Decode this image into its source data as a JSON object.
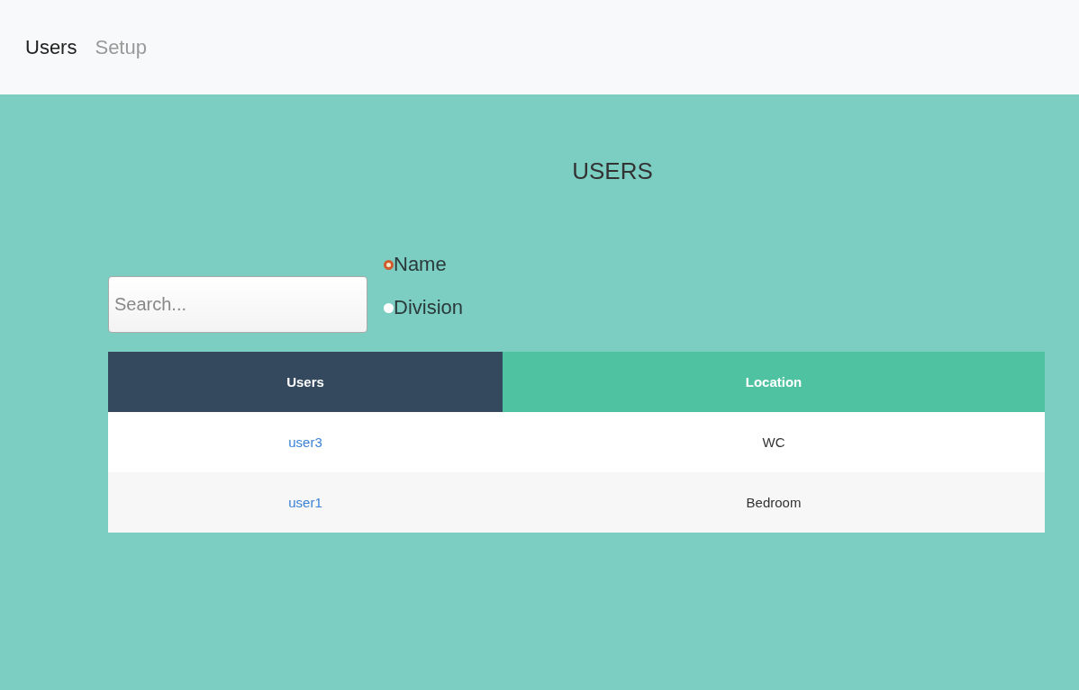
{
  "nav": [
    {
      "label": "Users",
      "selected": true
    },
    {
      "label": "Setup",
      "selected": false
    }
  ],
  "title": "USERS",
  "search": {
    "placeholder": "Search..."
  },
  "filters": [
    {
      "label": "Name",
      "selected": true
    },
    {
      "label": "Division",
      "selected": false
    }
  ],
  "table": {
    "columns": [
      {
        "label": "Users",
        "color": "#34495e"
      },
      {
        "label": "Location",
        "color": "#4fc3a1"
      }
    ],
    "rows": [
      {
        "user": "user3",
        "location": "WC"
      },
      {
        "user": "user1",
        "location": "Bedroom"
      }
    ]
  }
}
